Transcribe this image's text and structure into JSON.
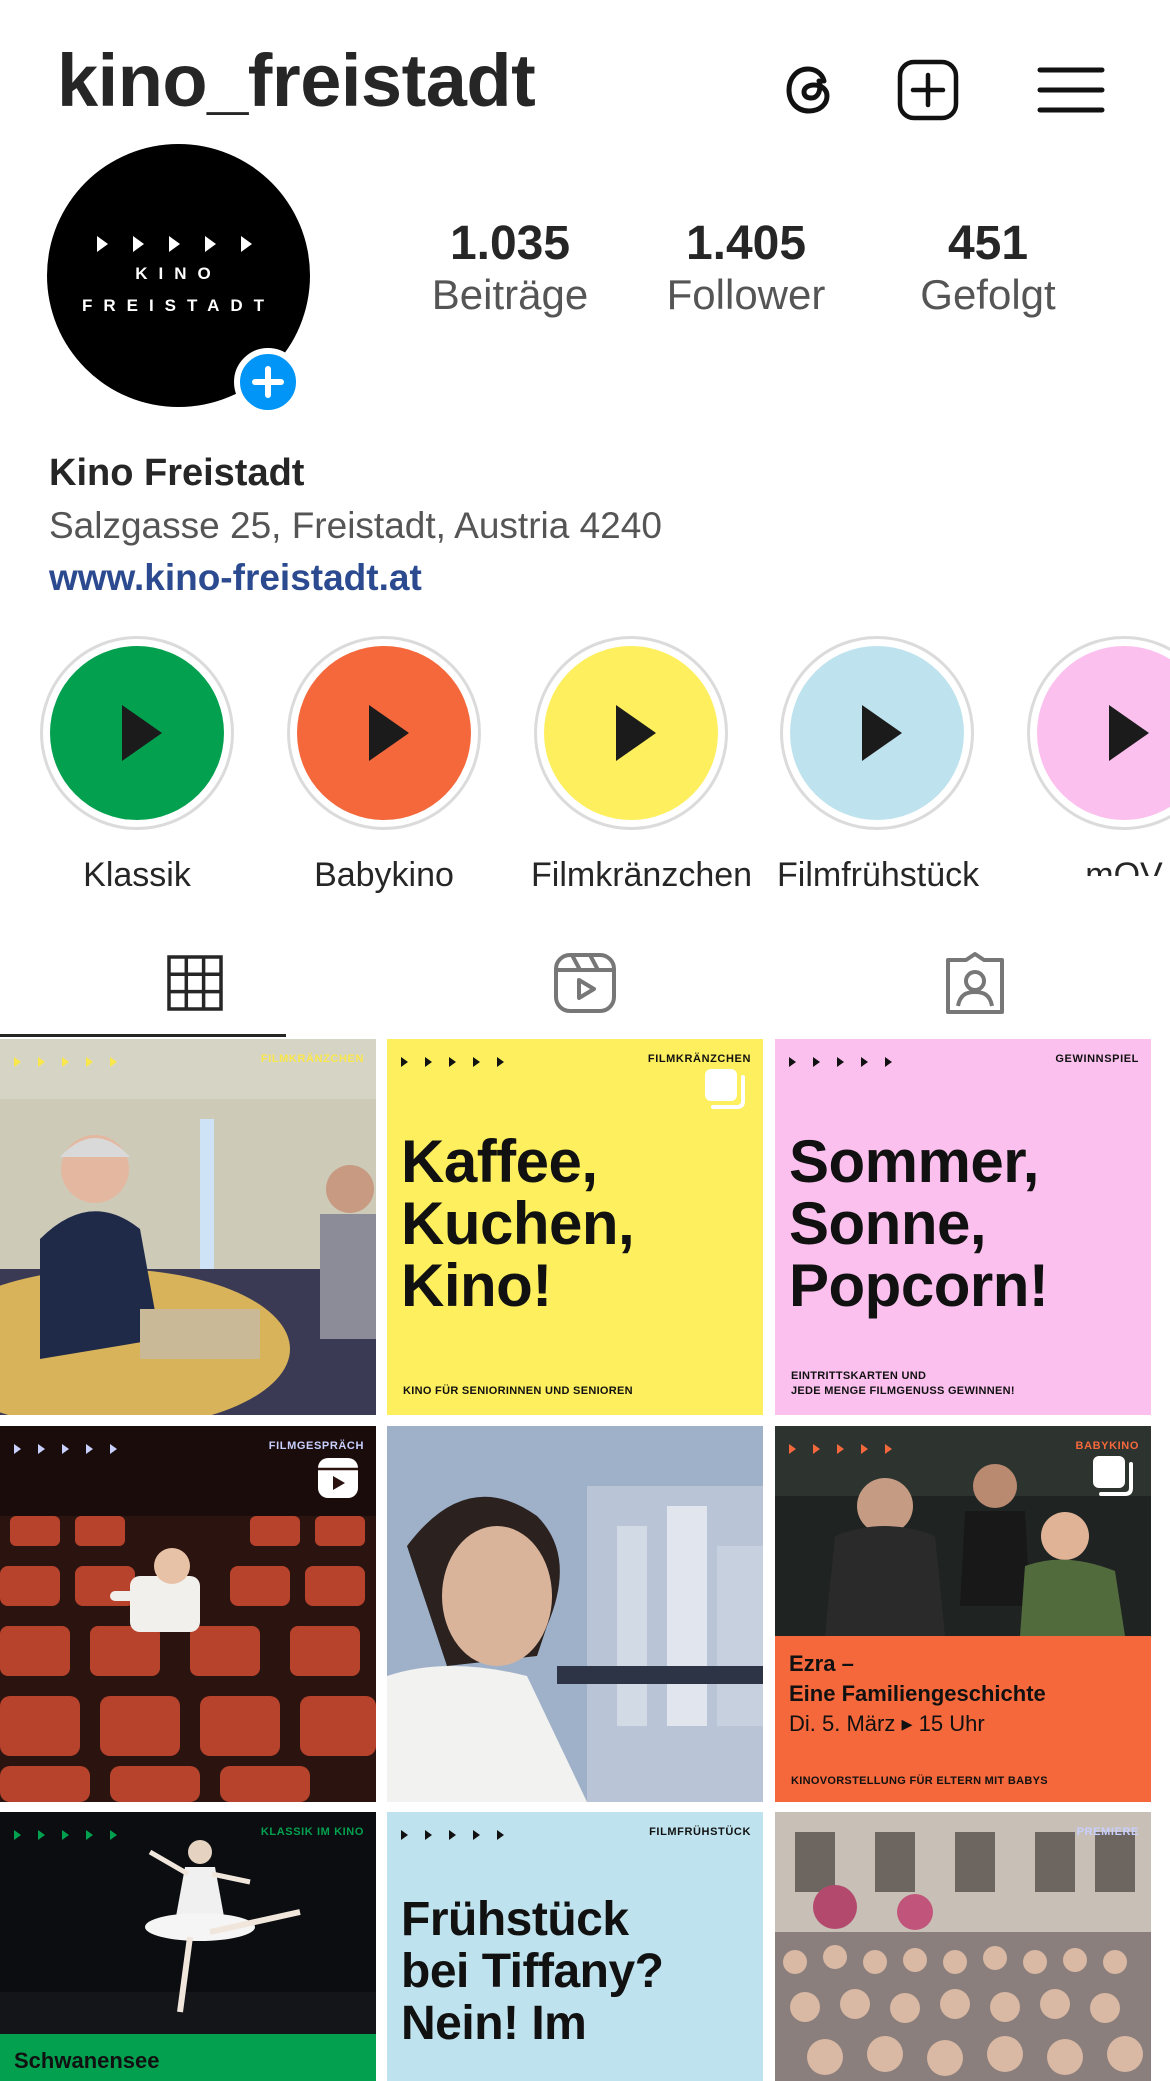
{
  "header": {
    "username": "kino_freistadt",
    "threads_icon": "threads-icon",
    "create_icon": "plus-square-icon",
    "menu_icon": "hamburger-menu-icon"
  },
  "profile": {
    "avatar_text_line1": "KINO",
    "avatar_text_line2": "FREISTADT",
    "stats": [
      {
        "value": "1.035",
        "label": "Beiträge"
      },
      {
        "value": "1.405",
        "label": "Follower"
      },
      {
        "value": "451",
        "label": "Gefolgt"
      }
    ],
    "name": "Kino Freistadt",
    "address": "Salzgasse 25, Freistadt, Austria 4240",
    "link": "www.kino-freistadt.at"
  },
  "highlights": [
    {
      "label": "Klassik",
      "color": "#03a14f"
    },
    {
      "label": "Babykino",
      "color": "#f4683c"
    },
    {
      "label": "Filmkränzchen",
      "color": "#fdef5d"
    },
    {
      "label": "Filmfrühstück",
      "color": "#bfe3ee"
    },
    {
      "label": "mOV",
      "color": "#fbc0ee"
    }
  ],
  "tabs": [
    {
      "name": "grid-icon"
    },
    {
      "name": "reels-icon"
    },
    {
      "name": "tagged-icon"
    }
  ],
  "posts": [
    {
      "tag": "FILMKRÄNZCHEN",
      "type": "photo-panel",
      "colors": [
        "#c9c6b4",
        "#1e2a4a"
      ]
    },
    {
      "tag": "FILMKRÄNZCHEN",
      "headline": "Kaffee,\nKuchen,\nKino!",
      "footer": "KINO FÜR SENIORINNEN UND SENIOREN",
      "bg": "#fdef5d"
    },
    {
      "tag": "GEWINNSPIEL",
      "headline": "Sommer,\nSonne,\nPopcorn!",
      "footer": "EINTRITTSKARTEN UND\nJEDE MENGE FILMGENUSS GEWINNEN!",
      "bg": "#fbc0ee"
    },
    {
      "tag": "FILMGESPRÄCH",
      "type": "cinema-seats",
      "colors": [
        "#3a1a14",
        "#b8432c"
      ]
    },
    {
      "tag": "",
      "type": "city-portrait",
      "colors": [
        "#8aa0bc",
        "#c9d4e2"
      ]
    },
    {
      "tag": "BABYKINO",
      "title_line1": "Ezra –",
      "title_line2": "Eine Familiengeschichte",
      "date": "Di. 5. März ▸ 15 Uhr",
      "footer": "KINOVORSTELLUNG FÜR ELTERN MIT BABYS",
      "bg": "#f4683c"
    },
    {
      "tag": "KLASSIK IM KINO",
      "caption": "Schwanensee",
      "bg": "#03a14f"
    },
    {
      "tag": "FILMFRÜHSTÜCK",
      "headline": "Frühstück\nbei Tiffany?\nNein! Im",
      "bg": "#bfe3ee"
    },
    {
      "tag": "PREMIERE",
      "type": "outdoor-crowd",
      "colors": [
        "#7b6c6a",
        "#cfc7c0"
      ]
    }
  ]
}
